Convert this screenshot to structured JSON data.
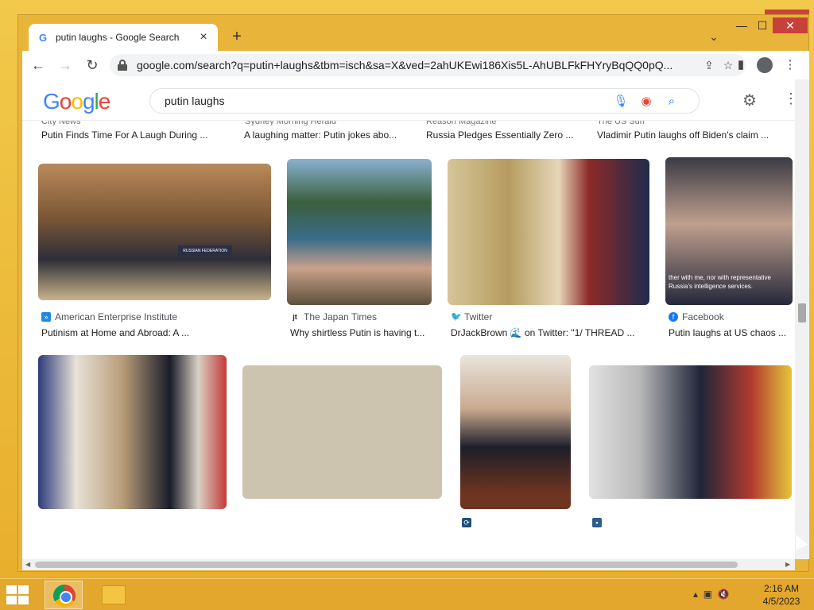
{
  "browser": {
    "tab_title": "putin laughs - Google Search",
    "tab_favicon": "G",
    "new_tab": "+",
    "tab_search": "⌄",
    "url": "google.com/search?q=putin+laughs&tbm=isch&sa=X&ved=2ahUKEwi186Xis5L-AhUBLFkFHYryBqQQ0pQ...",
    "back": "←",
    "forward": "→",
    "reload": "↻",
    "window_min": "—",
    "window_max": "☐",
    "window_close": "✕"
  },
  "google": {
    "logo": {
      "l1": "G",
      "l2": "o",
      "l3": "o",
      "l4": "g",
      "l5": "l",
      "l6": "e"
    },
    "query": "putin laughs"
  },
  "top_row": [
    {
      "source": "City News",
      "title": "Putin Finds Time For A Laugh During ..."
    },
    {
      "source": "Sydney Morning Herald",
      "title": "A laughing matter: Putin jokes abo..."
    },
    {
      "source": "Reason Magazine",
      "title": "Russia Pledges Essentially Zero ..."
    },
    {
      "source": "The US Sun",
      "title": "Vladimir Putin laughs off Biden's claim ..."
    }
  ],
  "row2": [
    {
      "source": "American Enterprise Institute",
      "title": "Putinism at Home and Abroad: A ...",
      "icon_color": "#1e88e5"
    },
    {
      "source": "The Japan Times",
      "title": "Why shirtless Putin is having t...",
      "icon_glyph": "jt",
      "icon_color": "#222222"
    },
    {
      "source": "Twitter",
      "title": "DrJackBrown 🌊 on Twitter: \"1/ THREAD ...",
      "icon_color": "#1d9bf0"
    },
    {
      "source": "Facebook",
      "title": "Putin laughs at US chaos ...",
      "icon_color": "#1877f2"
    }
  ],
  "facebook_caption": "ther with me, nor with representative\nRussia's intelligence services.",
  "nameplate": "RUSSIAN FEDERATION",
  "taskbar": {
    "time": "2:16 AM",
    "date": "4/5/2023"
  }
}
